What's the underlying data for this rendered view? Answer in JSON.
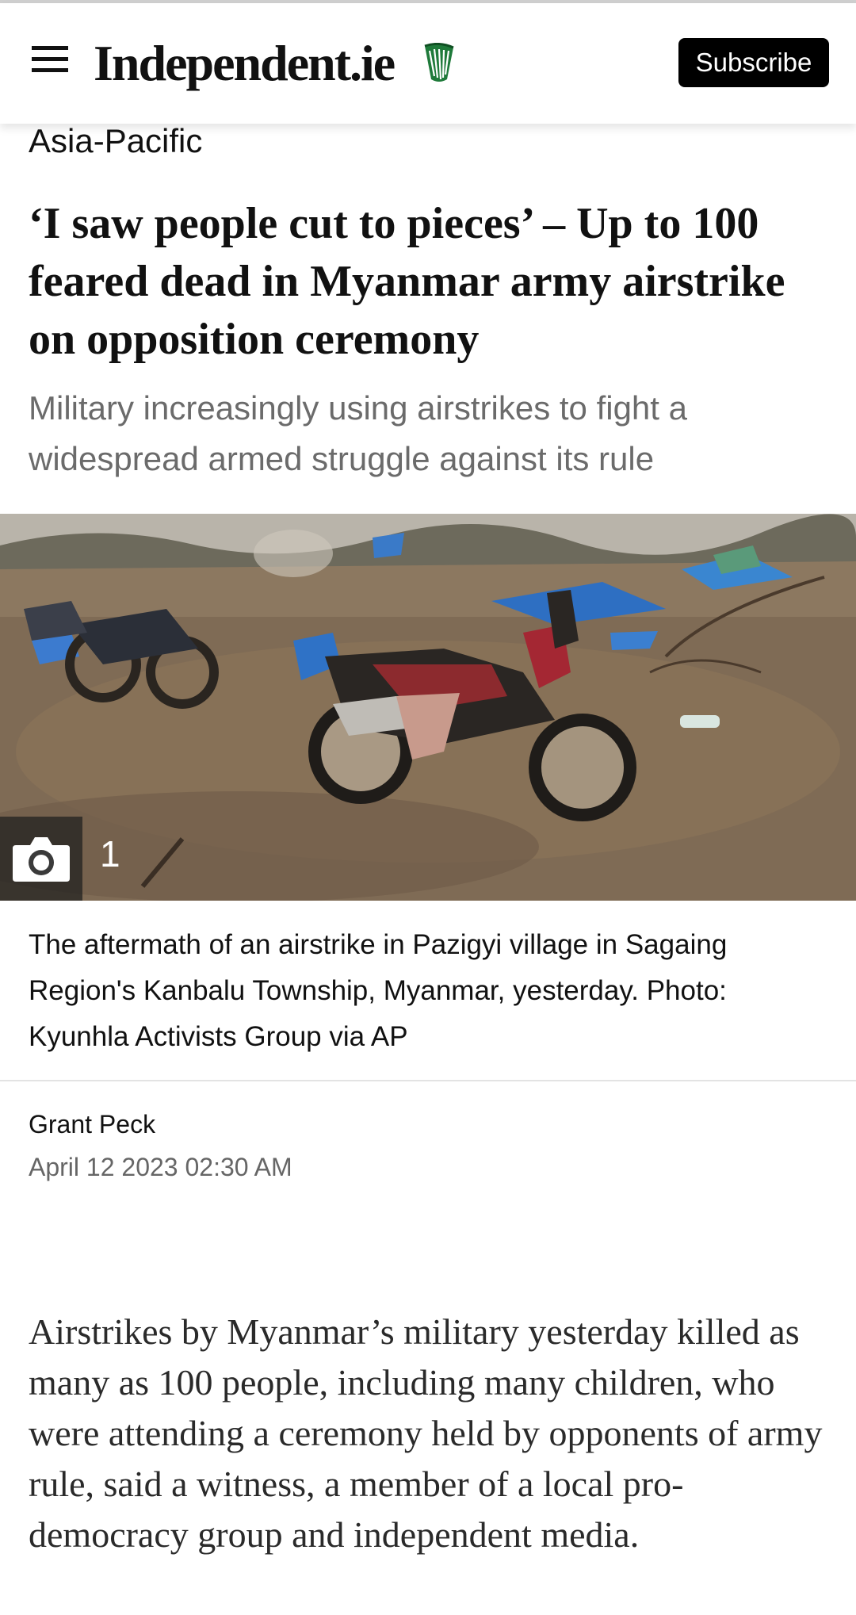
{
  "header": {
    "logo_text": "Independent.ie",
    "subscribe_label": "Subscribe",
    "brand_color": "#1f7a3a"
  },
  "article": {
    "section": "Asia-Pacific",
    "headline": "‘I saw people cut to pieces’ – Up to 100 feared dead in Myanmar army airstrike on opposition ceremony",
    "standfirst": "Military increasingly using airstrikes to fight a widespread armed struggle against its rule",
    "image": {
      "gallery_count": "1",
      "icon": "camera-icon"
    },
    "caption": "The aftermath of an airstrike in Pazigyi village in Sagaing Region's Kanbalu Township, Myanmar, yesterday. Photo: Kyunhla Activists Group via AP",
    "author": "Grant Peck",
    "date": "April 12 2023 02:30 AM",
    "body": "Airstrikes by Myanmar’s military yesterday killed as many as 100 people, including many children, who were attending a ceremony held by opponents of army rule, said a witness, a member of a local pro-democracy group and independent media."
  }
}
